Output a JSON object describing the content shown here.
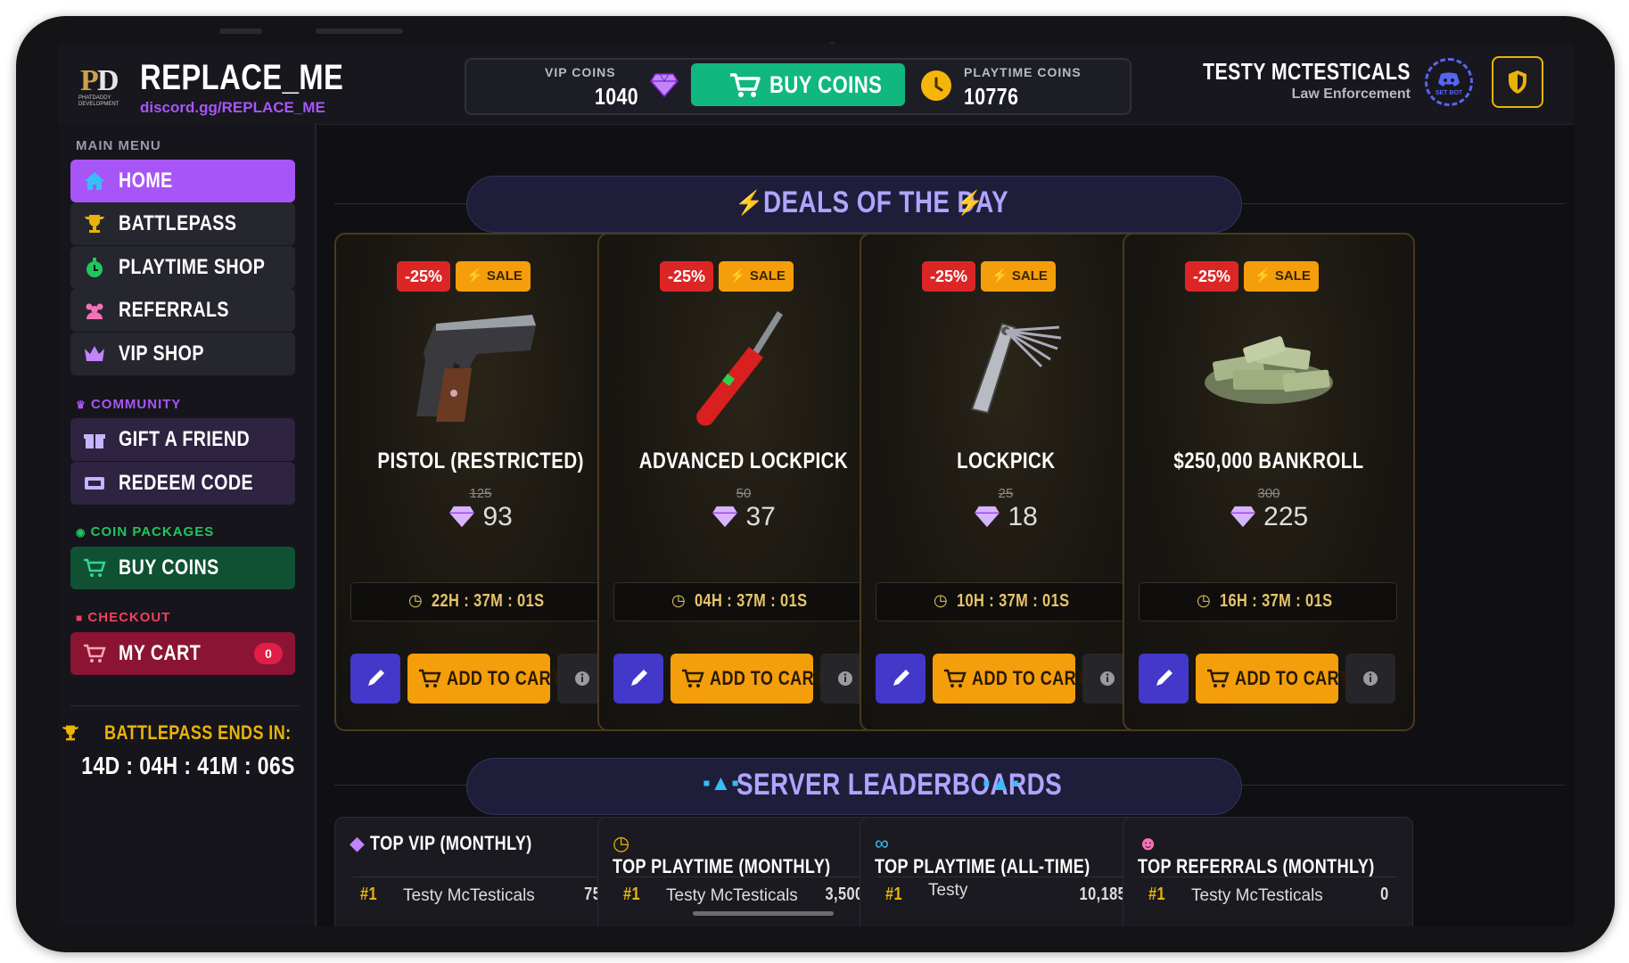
{
  "header": {
    "brand": "REPLACE_ME",
    "discord_link": "discord.gg/REPLACE_ME",
    "logo_text": "PD",
    "logo_sub": "PHATDADDY DEVELOPMENT",
    "vip_coins_label": "VIP COINS",
    "vip_coins_value": "1040",
    "buy_coins_label": "BUY COINS",
    "playtime_coins_label": "PLAYTIME COINS",
    "playtime_coins_value": "10776",
    "user_name": "TESTY MCTESTICALS",
    "user_role": "Law Enforcement",
    "discord_badge": "SET BOT",
    "colors": {
      "accent": "#a855f7",
      "buy": "#10b77f",
      "gold": "#eab308"
    }
  },
  "sidebar": {
    "main_menu_label": "MAIN MENU",
    "main_items": [
      {
        "label": "HOME",
        "icon": "home-icon"
      },
      {
        "label": "BATTLEPASS",
        "icon": "trophy-icon"
      },
      {
        "label": "PLAYTIME SHOP",
        "icon": "stopwatch-icon"
      },
      {
        "label": "REFERRALS",
        "icon": "users-icon"
      },
      {
        "label": "VIP SHOP",
        "icon": "crown-icon"
      }
    ],
    "community_label": "COMMUNITY",
    "community_items": [
      {
        "label": "GIFT A FRIEND",
        "icon": "gift-icon"
      },
      {
        "label": "REDEEM CODE",
        "icon": "ticket-icon"
      }
    ],
    "coin_packages_label": "COIN PACKAGES",
    "buy_coins_item": "BUY COINS",
    "checkout_label": "CHECKOUT",
    "my_cart_item": "MY CART",
    "cart_count": "0",
    "battlepass_ends_label": "BATTLEPASS ENDS IN:",
    "battlepass_countdown": "14D : 04H : 41M : 06S"
  },
  "deals": {
    "title": "DEALS OF THE DAY",
    "items": [
      {
        "discount": "-25%",
        "sale": "SALE",
        "name": "PISTOL (RESTRICTED)",
        "old_price": "125",
        "price": "93",
        "timer": "22H : 37M : 01S",
        "add_label": "ADD TO CART",
        "image": "pistol"
      },
      {
        "discount": "-25%",
        "sale": "SALE",
        "name": "ADVANCED LOCKPICK",
        "old_price": "50",
        "price": "37",
        "timer": "04H : 37M : 01S",
        "add_label": "ADD TO CART",
        "image": "advanced-lockpick"
      },
      {
        "discount": "-25%",
        "sale": "SALE",
        "name": "LOCKPICK",
        "old_price": "25",
        "price": "18",
        "timer": "10H : 37M : 01S",
        "add_label": "ADD TO CART",
        "image": "lockpick"
      },
      {
        "discount": "-25%",
        "sale": "SALE",
        "name": "$250,000 BANKROLL",
        "old_price": "300",
        "price": "225",
        "timer": "16H : 37M : 01S",
        "add_label": "ADD TO CART",
        "image": "money-stack"
      }
    ]
  },
  "leaderboards": {
    "title": "SERVER LEADERBOARDS",
    "boards": [
      {
        "title": "TOP VIP (MONTHLY)",
        "icon": "gem-icon",
        "rank": "#1",
        "name": "Testy McTesticals",
        "value": "75"
      },
      {
        "title": "TOP PLAYTIME (MONTHLY)",
        "icon": "clock-icon",
        "rank": "#1",
        "name": "Testy McTesticals",
        "value": "3,500"
      },
      {
        "title": "TOP PLAYTIME (ALL-TIME)",
        "icon": "infinity-icon",
        "rank": "#1",
        "name": "Testy",
        "value": "10,185"
      },
      {
        "title": "TOP REFERRALS (MONTHLY)",
        "icon": "users-icon",
        "rank": "#1",
        "name": "Testy McTesticals",
        "value": "0"
      }
    ]
  }
}
